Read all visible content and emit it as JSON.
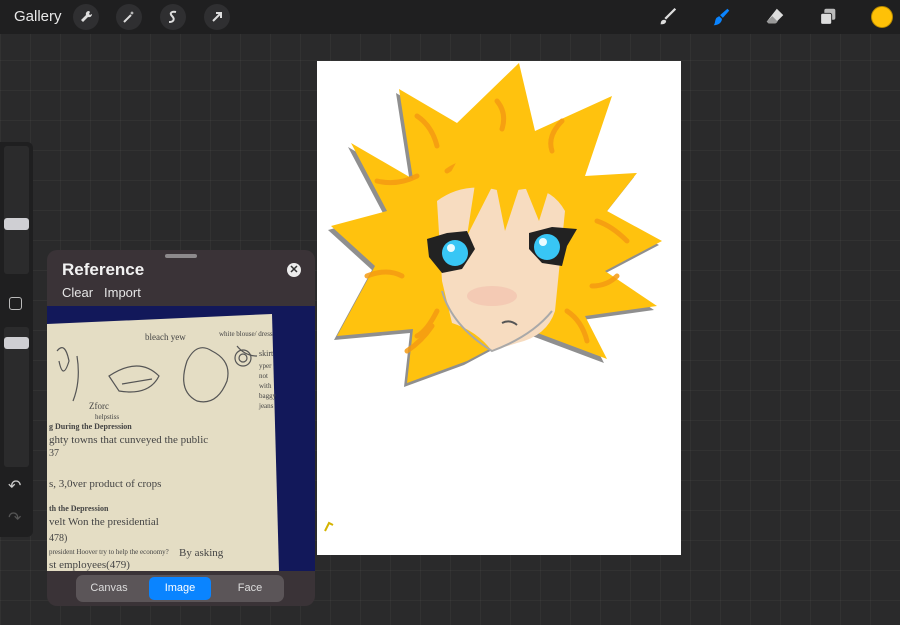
{
  "topbar": {
    "gallery_label": "Gallery",
    "left_tools": [
      "wrench-icon",
      "magic-wand-icon",
      "selection-icon",
      "transform-arrow-icon"
    ],
    "right_tools": [
      "brush-icon",
      "smudge-icon",
      "eraser-icon",
      "layers-icon"
    ],
    "active_tool": "smudge-icon",
    "current_color": "#ffc107"
  },
  "sidebar": {
    "brush_size_level": 0.55,
    "opacity_level": 0.8,
    "undo_icon": "undo-icon",
    "redo_icon": "redo-icon"
  },
  "reference": {
    "title": "Reference",
    "clear_label": "Clear",
    "import_label": "Import",
    "close_icon": "close-icon",
    "tabs": [
      {
        "label": "Canvas",
        "active": false
      },
      {
        "label": "Image",
        "active": true
      },
      {
        "label": "Face",
        "active": false
      }
    ],
    "sketch_texts": {
      "t1": "bleach yew",
      "t2": "white blouse/ dress",
      "t3": "skirt",
      "t4": "yper",
      "t5": "not",
      "t6": "with",
      "t7": "baggy",
      "t8": "jeans",
      "t9": "Zforc",
      "t10": "helpstiss",
      "line1": "g During the Depression",
      "line2": "ghty towns that cunveyed the public",
      "line3": "37",
      "line4": "s, 3,0ver product of crops",
      "line5": "th the Depression",
      "line6": "velt Won the presidential",
      "line7": "478)",
      "line8": "president Hoover try to help the economy?",
      "line9": "By asking",
      "line10": "st employees(479)"
    }
  },
  "colors": {
    "accent": "#0a84ff",
    "hair": "#ffc107",
    "eyes": "#38c6f5"
  }
}
